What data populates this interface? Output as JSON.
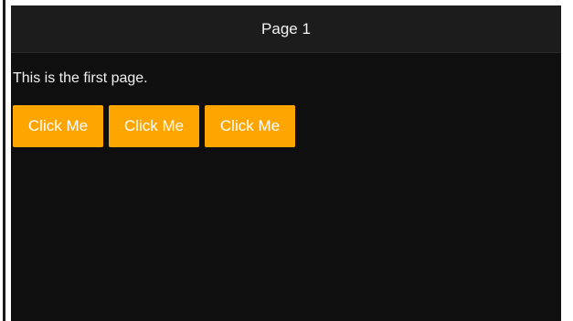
{
  "header": {
    "title": "Page 1"
  },
  "main": {
    "text": "This is the first page."
  },
  "buttons": [
    {
      "label": "Click Me"
    },
    {
      "label": "Click Me"
    },
    {
      "label": "Click Me"
    }
  ],
  "colors": {
    "background": "#0f0f0f",
    "header_background": "#1c1c1c",
    "button_background": "#ffa500",
    "text": "#f0f0f0"
  }
}
